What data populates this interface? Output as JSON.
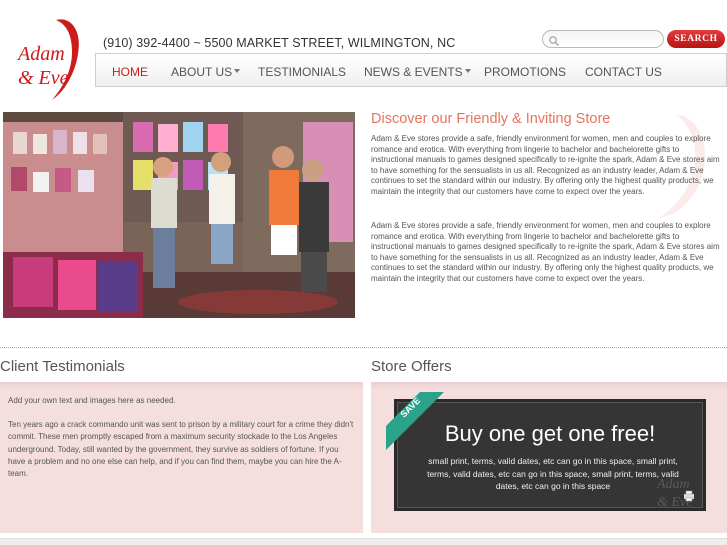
{
  "brand": {
    "logo_lines": [
      "Adam",
      "& Eve"
    ],
    "accent_color": "#cc1b1b",
    "title_color": "#e7735f"
  },
  "header": {
    "address": "(910) 392-4400 ~ 5500 MARKET STREET, WILMINGTON, NC",
    "search_placeholder": "",
    "search_button": "SEARCH",
    "search_icon": "search-icon"
  },
  "nav": {
    "items": [
      {
        "label": "HOME",
        "active": true,
        "dropdown": false
      },
      {
        "label": "ABOUT US",
        "active": false,
        "dropdown": true
      },
      {
        "label": "TESTIMONIALS",
        "active": false,
        "dropdown": false
      },
      {
        "label": "NEWS & EVENTS",
        "active": false,
        "dropdown": true
      },
      {
        "label": "PROMOTIONS",
        "active": false,
        "dropdown": false
      },
      {
        "label": "CONTACT US",
        "active": false,
        "dropdown": false
      }
    ]
  },
  "store": {
    "title": "Discover our Friendly & Inviting Store",
    "paragraphs": [
      "Adam & Eve stores provide a safe, friendly environment for women, men and couples to explore romance and erotica. With everything from lingerie to bachelor and bachelorette gifts to instructional manuals to games designed specifically to re-ignite the spark, Adam & Eve stores aim to have something for the sensualists in us all. Recognized as an industry leader, Adam & Eve continues to set the standard within our industry. By offering only the highest quality products, we maintain the integrity that our customers have come to expect over the years.",
      "Adam & Eve stores provide a safe, friendly environment for women, men and couples to explore romance and erotica. With everything from lingerie to bachelor and bachelorette gifts to instructional manuals to games designed specifically to re-ignite the spark, Adam & Eve stores aim to have something for the sensualists in us all. Recognized as an industry leader, Adam & Eve continues to set the standard within our industry. By offering only the highest quality products, we maintain the integrity that our customers have come to expect over the years."
    ]
  },
  "testimonials": {
    "title": "Client Testimonials",
    "intro": "Add your own text and images here as needed.",
    "body": "Ten years ago a crack commando unit was sent to prison by a military court for a crime they didn't commit. These men promptly escaped from a maximum security stockade to the Los Angeles underground. Today, still wanted by the government, they survive as soldiers of fortune. If you have a problem and no one else can help, and if you can find them, maybe you can hire the A-team."
  },
  "offers": {
    "title": "Store Offers",
    "ribbon": "SAVE",
    "headline": "Buy one get one free!",
    "small_print": "small print, terms, valid dates, etc can go in this space, small print, terms, valid dates, etc can go in this space, small print, terms, valid dates, etc can go in this space"
  }
}
